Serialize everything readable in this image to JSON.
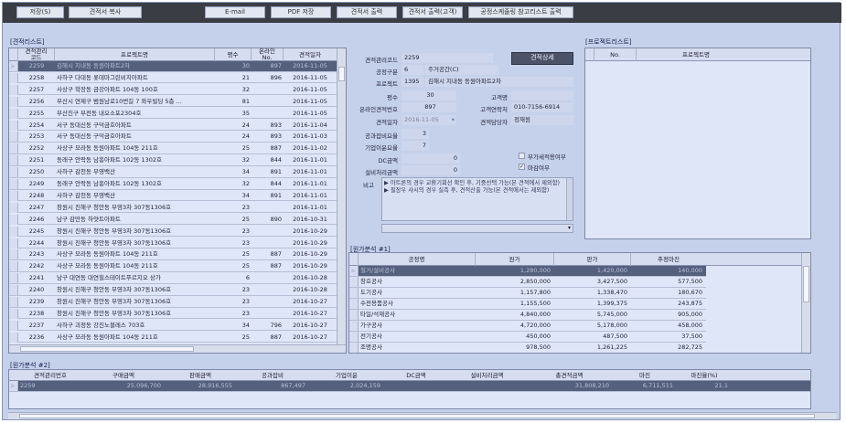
{
  "toolbar": {
    "buttons": [
      "저장(S)",
      "견적서 복사",
      "E-mail",
      "PDF 저장",
      "견적서 출력",
      "견적서 출력(고객)",
      "공정스케줄링 참고리스트 출력"
    ]
  },
  "estimate_list": {
    "title": "[견적리스트]",
    "headers": [
      "견적관리\n코드",
      "프로젝트명",
      "평수",
      "온라인\nNo.",
      "견적일자"
    ],
    "rows": [
      [
        "2259",
        "김해시 지내동 동원아파트2차",
        "30",
        "897",
        "2016-11-05"
      ],
      [
        "2258",
        "사하구 다대동 롯데마그린비치아파트",
        "21",
        "896",
        "2016-11-05"
      ],
      [
        "2257",
        "사상구 학장동 금강아파트 104동 100호",
        "32",
        "",
        "2016-11-05"
      ],
      [
        "2256",
        "부산시 연제구 범원남로10번길 7 와우빌딩 5층 ...",
        "81",
        "",
        "2016-11-05"
      ],
      [
        "2255",
        "부산진구 부전동 내오소포2304호",
        "35",
        "",
        "2016-11-05"
      ],
      [
        "2254",
        "서구 동대신동 구덕금호아파트",
        "24",
        "893",
        "2016-11-04"
      ],
      [
        "2253",
        "서구 동대신동 구덕금호아파트",
        "24",
        "893",
        "2016-11-03"
      ],
      [
        "2252",
        "사상구 모라동 동원아파트 104동 211호",
        "25",
        "887",
        "2016-11-02"
      ],
      [
        "2251",
        "동래구 안락동 남흥아파트 102동 1302호",
        "32",
        "844",
        "2016-11-01"
      ],
      [
        "2250",
        "사하구 감천동 부영백산",
        "34",
        "891",
        "2016-11-01"
      ],
      [
        "2249",
        "동래구 안락동 남흥아파트 102동 1302호",
        "32",
        "844",
        "2016-11-01"
      ],
      [
        "2248",
        "사하구 감천동 부영백산",
        "34",
        "891",
        "2016-11-01"
      ],
      [
        "2247",
        "창원시 진해구 청안동 부영3차 307동1306호",
        "23",
        "",
        "2016-11-01"
      ],
      [
        "2246",
        "남구 감만동 하얏트아파트",
        "25",
        "890",
        "2016-10-31"
      ],
      [
        "2245",
        "창원시 진해구 청안동 부영3차 307동1306호",
        "23",
        "",
        "2016-10-29"
      ],
      [
        "2244",
        "창원시 진해구 청안동 부영3차 307동1306호",
        "23",
        "",
        "2016-10-29"
      ],
      [
        "2243",
        "사상구 모라동 동원아파트 104동 211호",
        "25",
        "887",
        "2016-10-29"
      ],
      [
        "2242",
        "사상구 모라동 동원아파트 104동 211호",
        "25",
        "887",
        "2016-10-29"
      ],
      [
        "2241",
        "남구 대연동 대연힐스테이트푸르지오 상가",
        "6",
        "",
        "2016-10-28"
      ],
      [
        "2240",
        "창원시 진해구 청안동 부영3차 307동1306호",
        "23",
        "",
        "2016-10-28"
      ],
      [
        "2239",
        "창원시 진해구 청안동 부영3차 307동1306호",
        "23",
        "",
        "2016-10-27"
      ],
      [
        "2238",
        "창원시 진해구 청안동 부영3차 307동1306호",
        "23",
        "",
        "2016-10-27"
      ],
      [
        "2237",
        "사하구 괴정동 강진노블레스 703호",
        "34",
        "796",
        "2016-10-27"
      ],
      [
        "2236",
        "사상구 모라동 동원아파트 104동 211호",
        "25",
        "887",
        "2016-10-27"
      ]
    ]
  },
  "detail": {
    "detail_button": "견적상세",
    "code_label": "견적관리코드",
    "code_value": "2259",
    "type_label": "공정구분",
    "type_code": "6",
    "type_value": "주거공간(C)",
    "project_label": "프로젝트",
    "project_code": "1395",
    "project_value": "김해시 지내동 동원아파트2차",
    "area_label": "평수",
    "area_value": "30",
    "customer_label": "고객명",
    "customer_value": "",
    "online_label": "온라인견적번호",
    "online_value": "897",
    "contact_label": "고객연락처",
    "contact_value": "010-7156-6914",
    "date_label": "견적일자",
    "date_value": "2016-11-05",
    "manager_label": "견적담당자",
    "manager_value": "정재원",
    "overhead_label": "공과잡비요율",
    "overhead_value": "3",
    "profit_label": "기업이윤요율",
    "profit_value": "7",
    "dc_label": "DC금액",
    "dc_value": "0",
    "vat_label": "부가세적용여부",
    "close_label": "마감여부",
    "disposal_label": "설비처리금액",
    "disposal_value": "0",
    "note_label": "비고",
    "notes": [
      "▶ 아트론의 경우 교환기회선 확인 후, 기중선택 가능(본 견적에서 제외함)",
      "▶ 필장우 사시의 경우 실측 후, 견적산출 가능(본 견적에서는 제외함)"
    ]
  },
  "project_list": {
    "title": "[프로젝트리스트]",
    "headers": [
      "No.",
      "프로젝트명"
    ]
  },
  "cost_analysis1": {
    "title": "[원가분석 #1]",
    "headers": [
      "공정명",
      "원가",
      "판가",
      "추정마진"
    ],
    "rows": [
      [
        "철거/설비공사",
        "1,280,000",
        "1,420,000",
        "140,000"
      ],
      [
        "창호공사",
        "2,850,000",
        "3,427,500",
        "577,500"
      ],
      [
        "도기공사",
        "1,157,800",
        "1,338,470",
        "180,670"
      ],
      [
        "수전용품공사",
        "1,155,500",
        "1,399,375",
        "243,875"
      ],
      [
        "타일/석재공사",
        "4,840,000",
        "5,745,000",
        "905,000"
      ],
      [
        "가구공사",
        "4,720,000",
        "5,178,000",
        "458,000"
      ],
      [
        "전기공사",
        "450,000",
        "487,500",
        "37,500"
      ],
      [
        "조명공사",
        "978,500",
        "1,261,225",
        "282,725"
      ]
    ]
  },
  "cost_analysis2": {
    "title": "[원가분석 #2]",
    "headers": [
      "견적관리번호",
      "구매금액",
      "판매금액",
      "공과잡비",
      "기업이윤",
      "DC금액",
      "설비처리금액",
      "총견적금액",
      "마진",
      "마진율(%)"
    ],
    "row": [
      "2259",
      "25,096,700",
      "28,916,555",
      "867,497",
      "2,024,159",
      "",
      "",
      "31,808,210",
      "6,711,511",
      "21.1"
    ]
  }
}
